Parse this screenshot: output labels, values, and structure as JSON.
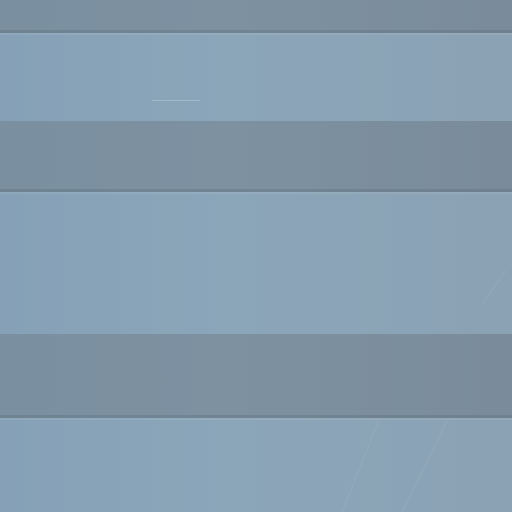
{
  "scene": {
    "stripes": [
      {
        "tone": "dark",
        "color": "#7c90a0"
      },
      {
        "tone": "light",
        "color": "#89a3b8"
      },
      {
        "tone": "dark",
        "color": "#7c90a0"
      },
      {
        "tone": "light",
        "color": "#89a3b8"
      },
      {
        "tone": "dark",
        "color": "#7c90a0"
      },
      {
        "tone": "light",
        "color": "#89a3b8"
      }
    ]
  }
}
